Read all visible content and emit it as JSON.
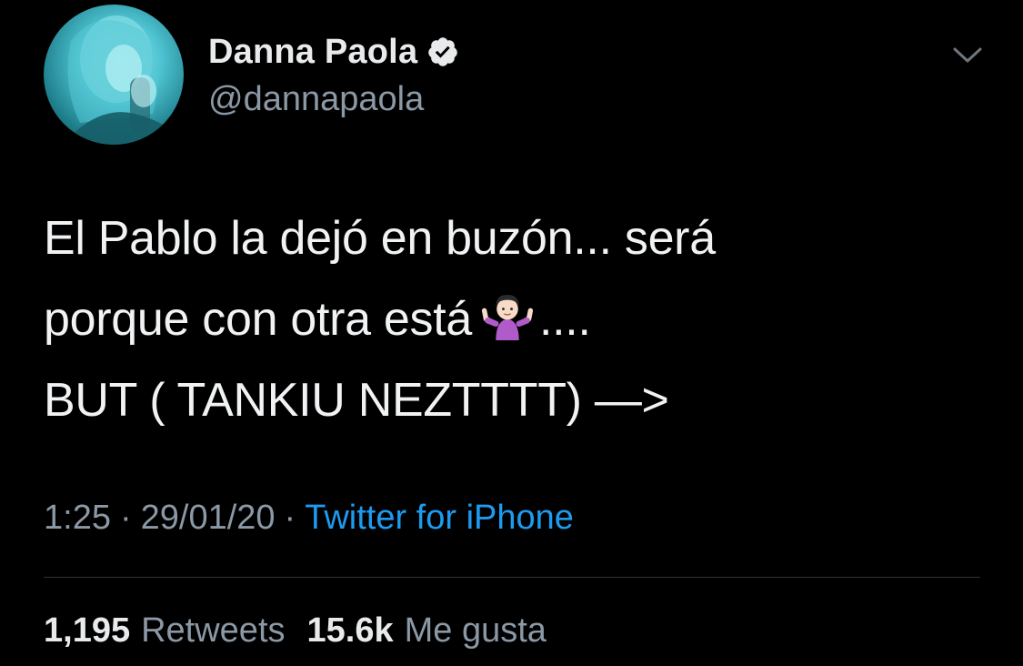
{
  "author": {
    "display_name": "Danna Paola",
    "handle": "@dannapaola",
    "verified": true,
    "avatar_icon": "profile-photo"
  },
  "tweet": {
    "lines": [
      "El Pablo la dejó en buzón... será",
      "porque con otra está",
      "....",
      "BUT ( TANKIU NEZTTTT) —>"
    ],
    "emoji": "woman-shrugging-emoji"
  },
  "meta": {
    "time": "1:25",
    "separator": "·",
    "date": "29/01/20",
    "source": "Twitter for iPhone"
  },
  "stats": {
    "retweets_count": "1,195",
    "retweets_label": "Retweets",
    "likes_count": "15.6k",
    "likes_label": "Me gusta"
  },
  "colors": {
    "background": "#000000",
    "name": "#e9eaeb",
    "secondary": "#8b98a5",
    "link": "#1d9bf0",
    "divider": "#2f3336"
  }
}
